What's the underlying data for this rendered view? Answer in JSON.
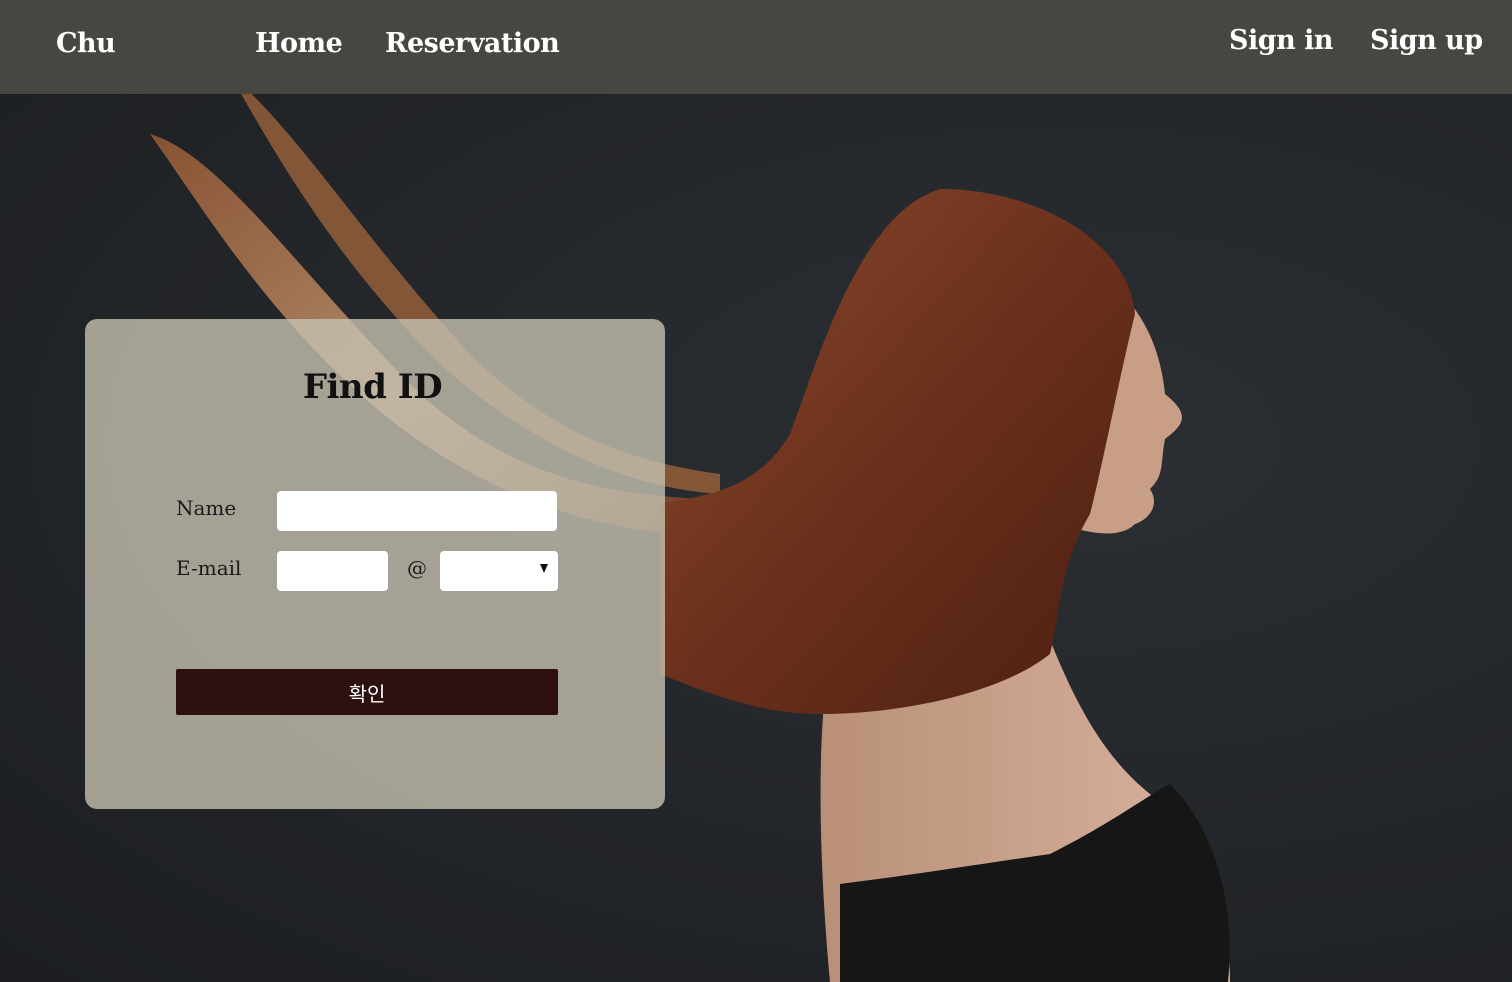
{
  "nav": {
    "brand": "Chu",
    "home": "Home",
    "reservation": "Reservation",
    "sign_in": "Sign in",
    "sign_up": "Sign up"
  },
  "hero": {
    "image": "woman-with-long-red-hair-photo"
  },
  "form": {
    "title": "Find ID",
    "name_label": "Name",
    "name_value": "",
    "email_label": "E-mail",
    "email_id_value": "",
    "at_sign": "@",
    "domain_selected": "",
    "dropdown_icon": "caret-down-icon",
    "confirm_label": "확인"
  },
  "colors": {
    "navbar_bg": "#474741",
    "page_bg": "#24272b",
    "card_bg": "#c6c0b0",
    "button_bg": "#2f1011",
    "hair": "#7a3a22"
  }
}
